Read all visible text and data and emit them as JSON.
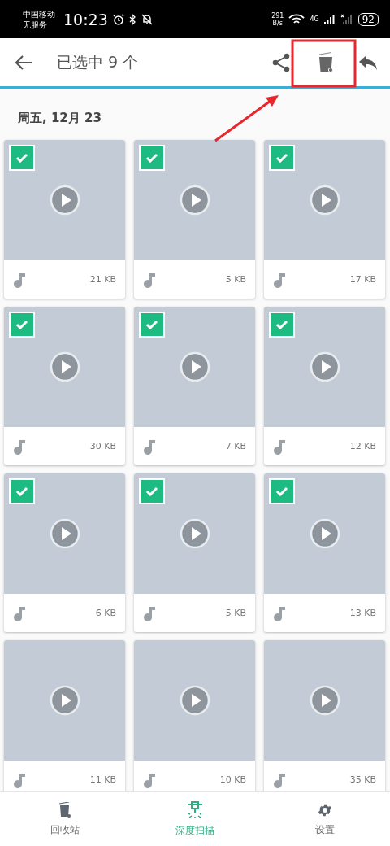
{
  "status_bar": {
    "carrier": "中国移动",
    "service": "无服务",
    "time": "10:23",
    "speed_value": "291",
    "speed_unit": "B/s",
    "network": "4G",
    "battery": "92"
  },
  "toolbar": {
    "title": "已选中 9 个"
  },
  "date_header": "周五, 12月 23",
  "items": [
    {
      "size": "21 KB",
      "checked": true
    },
    {
      "size": "5 KB",
      "checked": true
    },
    {
      "size": "17 KB",
      "checked": true
    },
    {
      "size": "30 KB",
      "checked": true
    },
    {
      "size": "7 KB",
      "checked": true
    },
    {
      "size": "12 KB",
      "checked": true
    },
    {
      "size": "6 KB",
      "checked": true
    },
    {
      "size": "5 KB",
      "checked": true
    },
    {
      "size": "13 KB",
      "checked": true
    },
    {
      "size": "11 KB",
      "checked": false
    },
    {
      "size": "10 KB",
      "checked": false
    },
    {
      "size": "35 KB",
      "checked": false
    }
  ],
  "bottom_nav": [
    {
      "label": "回收站",
      "kind": "trash",
      "selected": false
    },
    {
      "label": "深度扫描",
      "kind": "scan",
      "selected": true
    },
    {
      "label": "设置",
      "kind": "settings",
      "selected": false
    }
  ]
}
